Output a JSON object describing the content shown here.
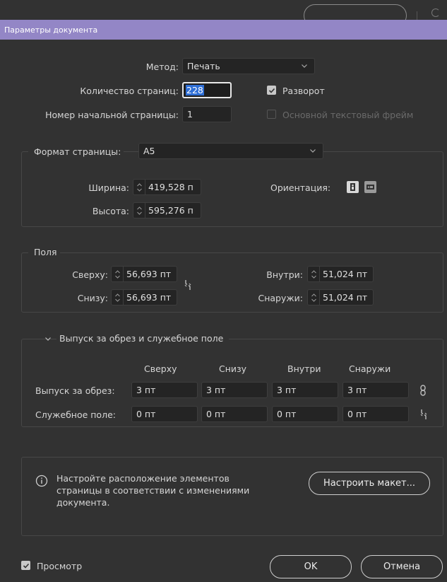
{
  "dialog": {
    "title": "Параметры документа"
  },
  "main": {
    "intent_label": "Метод:",
    "intent_value": "Печать",
    "pages_label": "Количество страниц:",
    "pages_value": "228",
    "start_page_label": "Номер начальной страницы:",
    "start_page_value": "1",
    "facing_pages_label": "Разворот",
    "facing_pages_checked": true,
    "primary_frame_label": "Основной текстовый фрейм",
    "primary_frame_checked": false
  },
  "page_size": {
    "label": "Формат страницы:",
    "value": "A5",
    "width_label": "Ширина:",
    "width_value": "419,528 п",
    "height_label": "Высота:",
    "height_value": "595,276 п",
    "orientation_label": "Ориентация:"
  },
  "margins": {
    "legend": "Поля",
    "top_label": "Сверху:",
    "top_value": "56,693 пт",
    "bottom_label": "Снизу:",
    "bottom_value": "56,693 пт",
    "inside_label": "Внутри:",
    "inside_value": "51,024 пт",
    "outside_label": "Снаружи:",
    "outside_value": "51,024 пт"
  },
  "bleed": {
    "legend": "Выпуск за обрез и служебное поле",
    "columns": [
      "Сверху",
      "Снизу",
      "Внутри",
      "Снаружи"
    ],
    "bleed_label": "Выпуск за обрез:",
    "bleed_values": [
      "3 пт",
      "3 пт",
      "3 пт",
      "3 пт"
    ],
    "slug_label": "Служебное поле:",
    "slug_values": [
      "0 пт",
      "0 пт",
      "0 пт",
      "0 пт"
    ]
  },
  "info": {
    "line1": "Настройте расположение элементов",
    "line2": "страницы в соответствии с изменениями",
    "line3": "документа.",
    "adjust_button": "Настроить макет..."
  },
  "footer": {
    "preview_label": "Просмотр",
    "preview_checked": true,
    "ok_label": "OK",
    "cancel_label": "Отмена"
  },
  "colors": {
    "titlebar": "#9386c6",
    "background": "#323232",
    "selection": "#2f6fd6"
  }
}
